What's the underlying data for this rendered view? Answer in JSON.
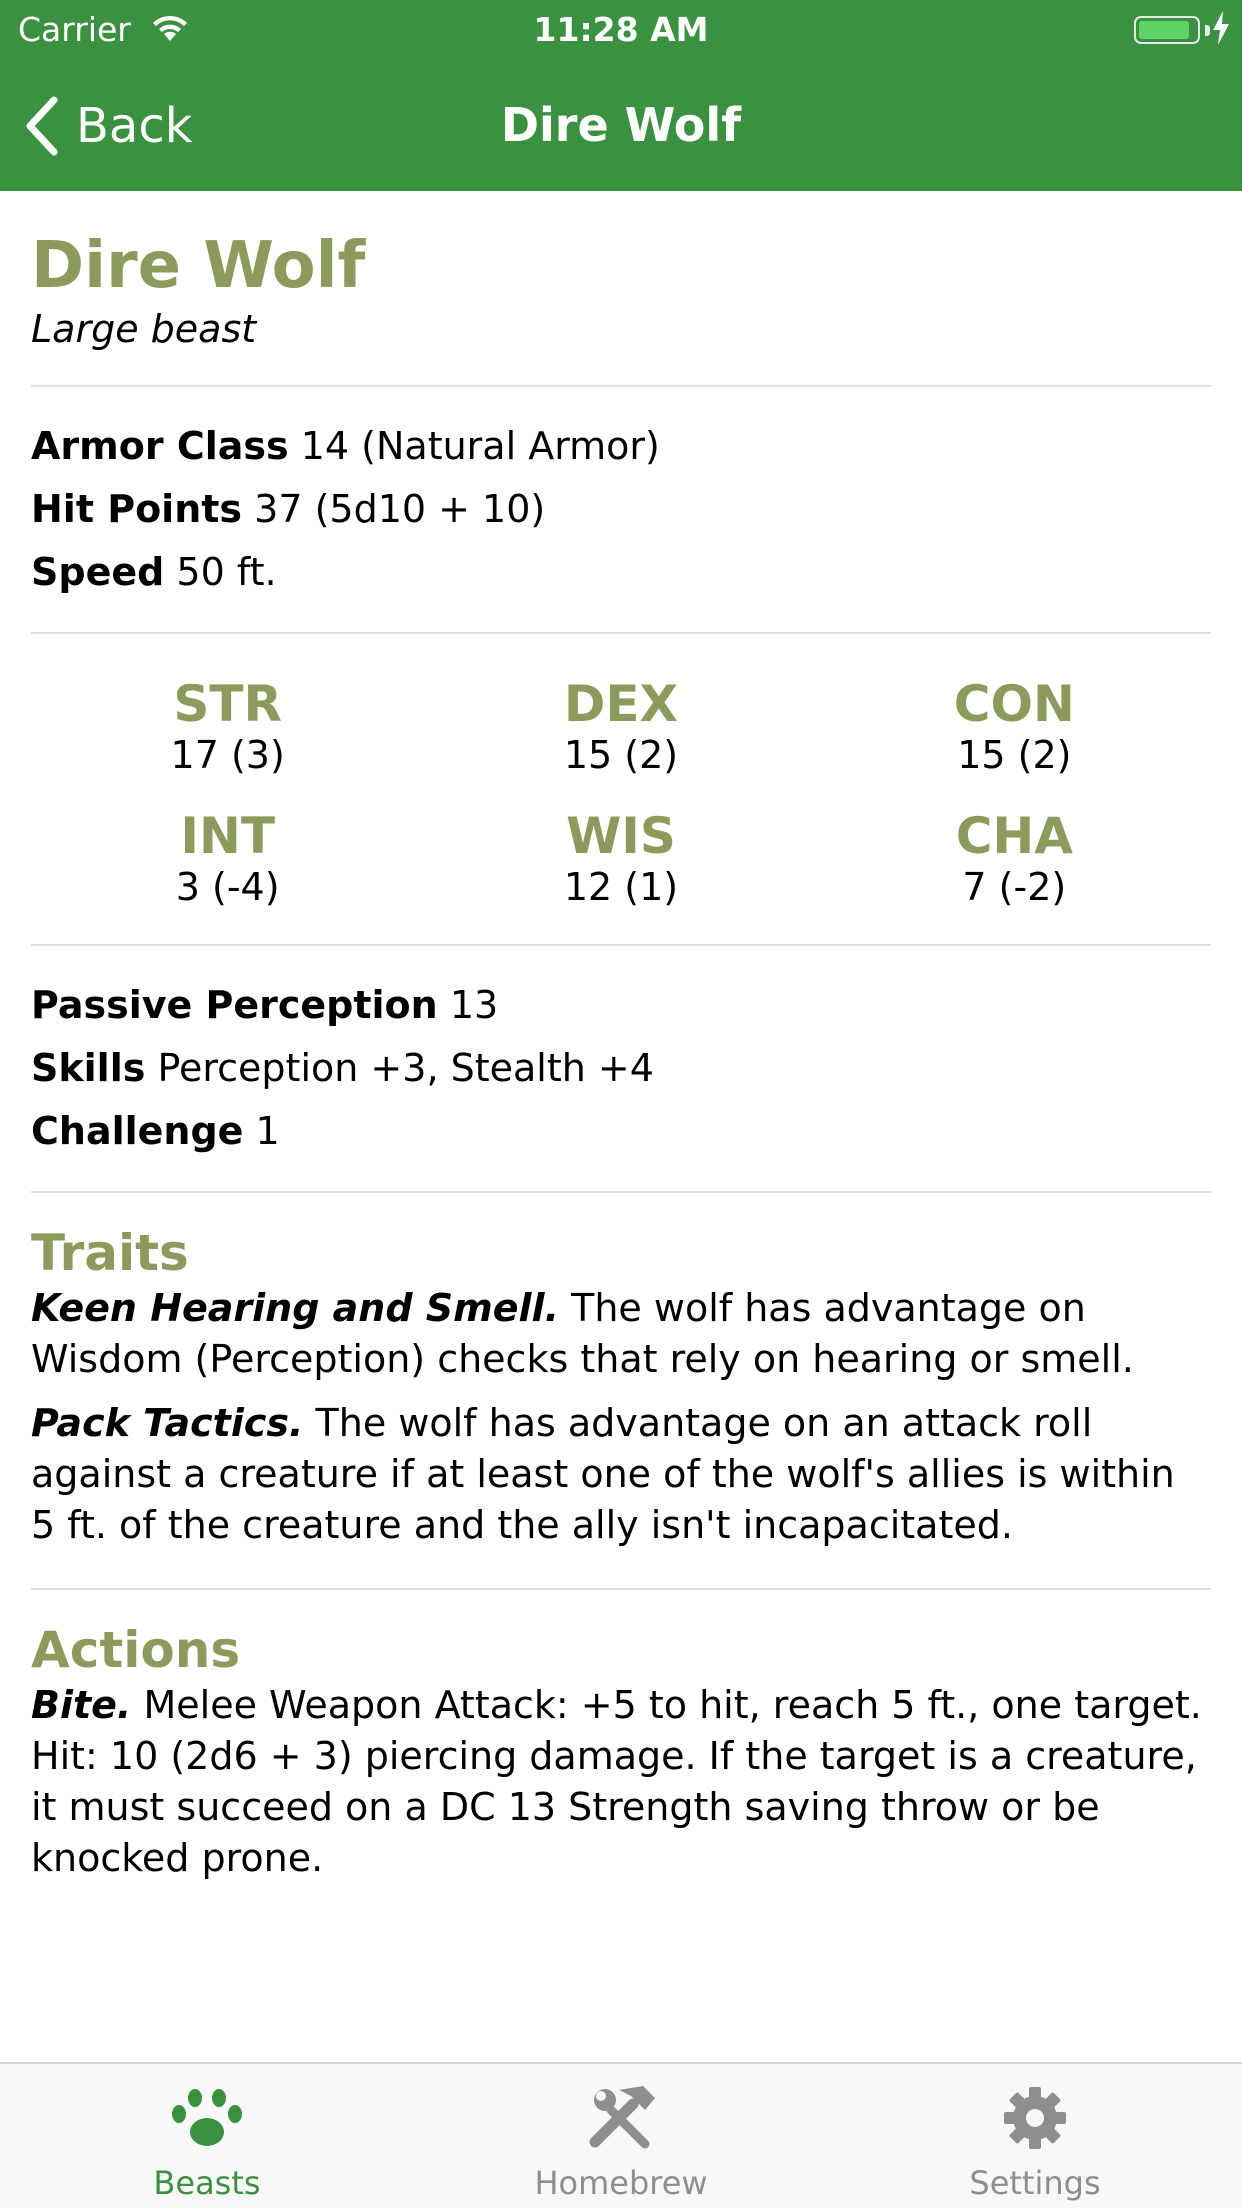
{
  "status_bar": {
    "carrier": "Carrier",
    "time": "11:28 AM",
    "battery_level": 0.9
  },
  "nav": {
    "back_label": "Back",
    "title": "Dire Wolf"
  },
  "creature": {
    "name": "Dire Wolf",
    "type": "Large beast",
    "armor_class": {
      "label": "Armor Class",
      "value": "14 (Natural Armor)"
    },
    "hit_points": {
      "label": "Hit Points",
      "value": "37 (5d10 + 10)"
    },
    "speed": {
      "label": "Speed",
      "value": "50 ft."
    },
    "abilities": [
      {
        "label": "STR",
        "value": "17 (3)"
      },
      {
        "label": "DEX",
        "value": "15 (2)"
      },
      {
        "label": "CON",
        "value": "15 (2)"
      },
      {
        "label": "INT",
        "value": "3 (-4)"
      },
      {
        "label": "WIS",
        "value": "12 (1)"
      },
      {
        "label": "CHA",
        "value": "7 (-2)"
      }
    ],
    "passive_perception": {
      "label": "Passive Perception",
      "value": "13"
    },
    "skills": {
      "label": "Skills",
      "value": "Perception +3, Stealth +4"
    },
    "challenge": {
      "label": "Challenge",
      "value": "1"
    },
    "traits_title": "Traits",
    "traits": [
      {
        "name": "Keen Hearing and Smell.",
        "text": "The wolf has advantage on Wisdom (Perception) checks that rely on hearing or smell."
      },
      {
        "name": "Pack Tactics.",
        "text": "The wolf has advantage on an attack roll against a creature if at least one of the wolf's allies is within 5 ft. of the creature and the ally isn't incapacitated."
      }
    ],
    "actions_title": "Actions",
    "actions": [
      {
        "name": "Bite.",
        "text": "Melee Weapon Attack: +5 to hit, reach 5 ft., one target. Hit: 10 (2d6 + 3) piercing damage. If the target is a creature, it must succeed on a DC 13 Strength saving throw or be knocked prone."
      }
    ]
  },
  "tabbar": {
    "tabs": [
      {
        "label": "Beasts",
        "icon": "paw-icon",
        "active": true
      },
      {
        "label": "Homebrew",
        "icon": "tools-icon",
        "active": false
      },
      {
        "label": "Settings",
        "icon": "gear-icon",
        "active": false
      }
    ]
  },
  "colors": {
    "nav_green": "#3a913f",
    "heading_olive": "#8c9a5b",
    "inactive_gray": "#8e8e8e"
  }
}
